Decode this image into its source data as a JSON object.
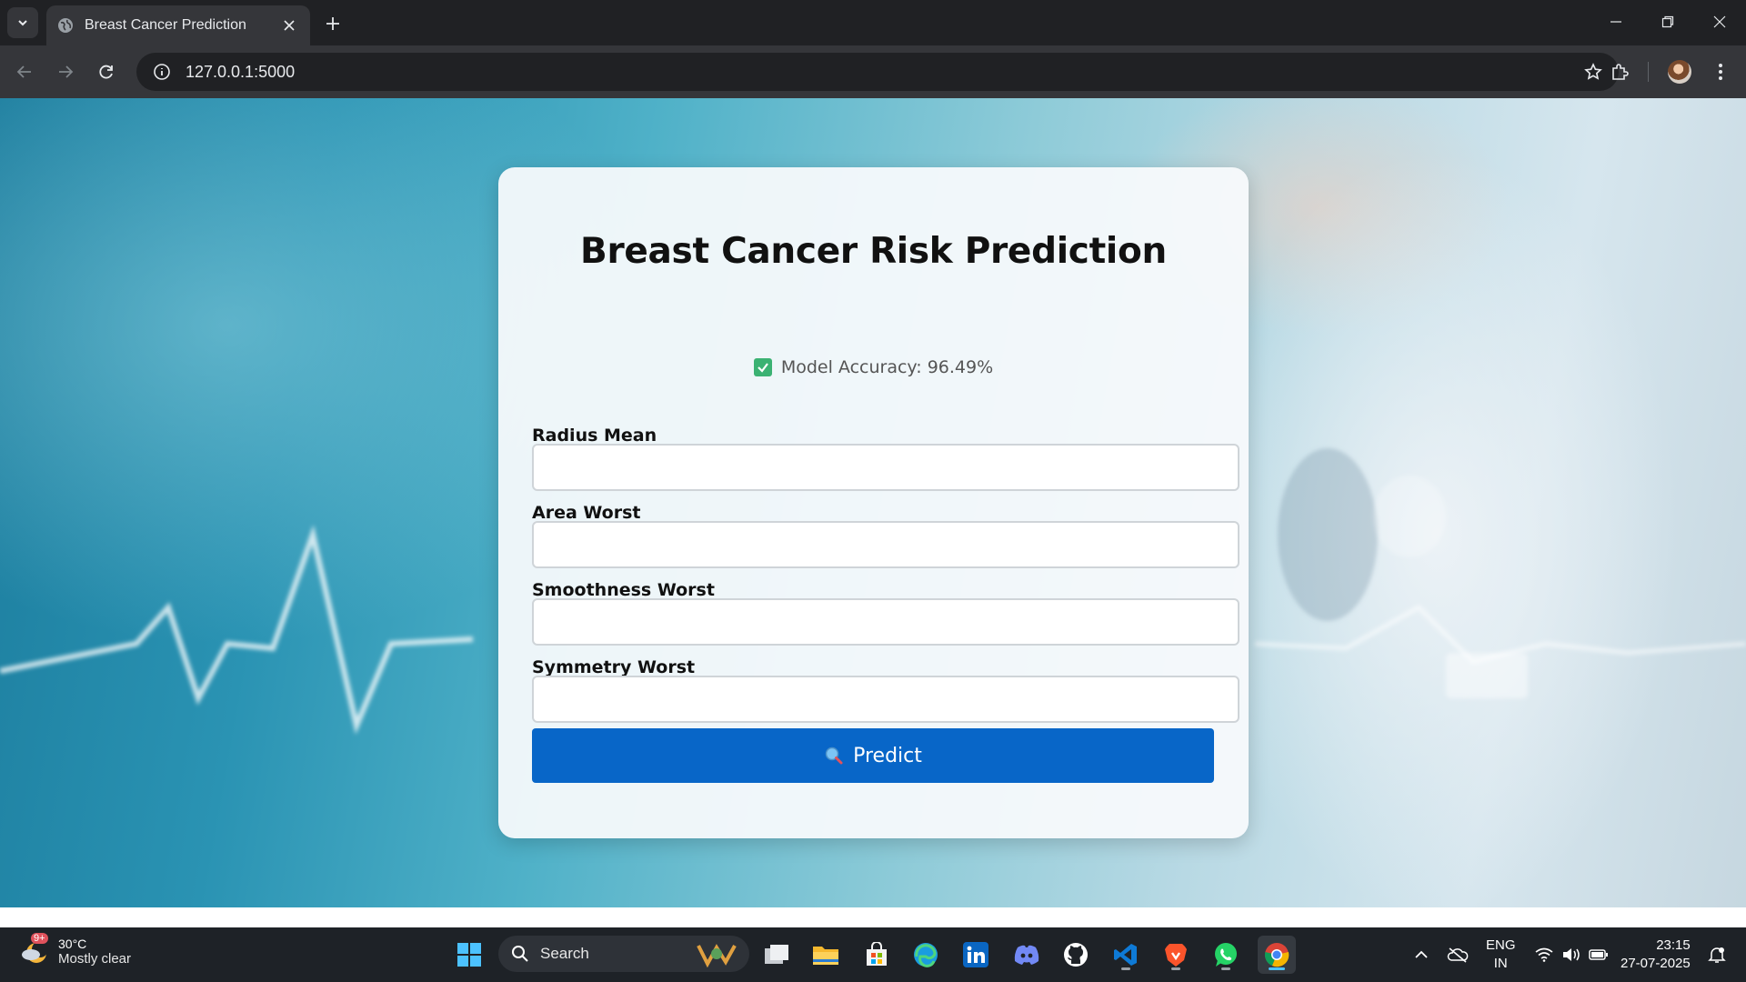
{
  "browser": {
    "tab_title": "Breast Cancer Prediction",
    "url": "127.0.0.1:5000"
  },
  "page": {
    "title": "Breast Cancer Risk Prediction",
    "accuracy_text": "Model Accuracy: 96.49%",
    "fields": [
      {
        "label": "Radius Mean",
        "value": ""
      },
      {
        "label": "Area Worst",
        "value": ""
      },
      {
        "label": "Smoothness Worst",
        "value": ""
      },
      {
        "label": "Symmetry Worst",
        "value": ""
      }
    ],
    "predict_label": "Predict",
    "predict_color": "#0866c8",
    "accent_check_color": "#3bb273"
  },
  "taskbar": {
    "weather_badge": "9+",
    "temperature": "30°C",
    "condition": "Mostly clear",
    "search_label": "Search",
    "pinned_apps": [
      "task-view",
      "file-explorer",
      "microsoft-store",
      "edge",
      "linkedin",
      "discord",
      "github",
      "vscode",
      "brave",
      "whatsapp",
      "chrome"
    ],
    "lang_top": "ENG",
    "lang_bottom": "IN",
    "time": "23:15",
    "date": "27-07-2025"
  }
}
